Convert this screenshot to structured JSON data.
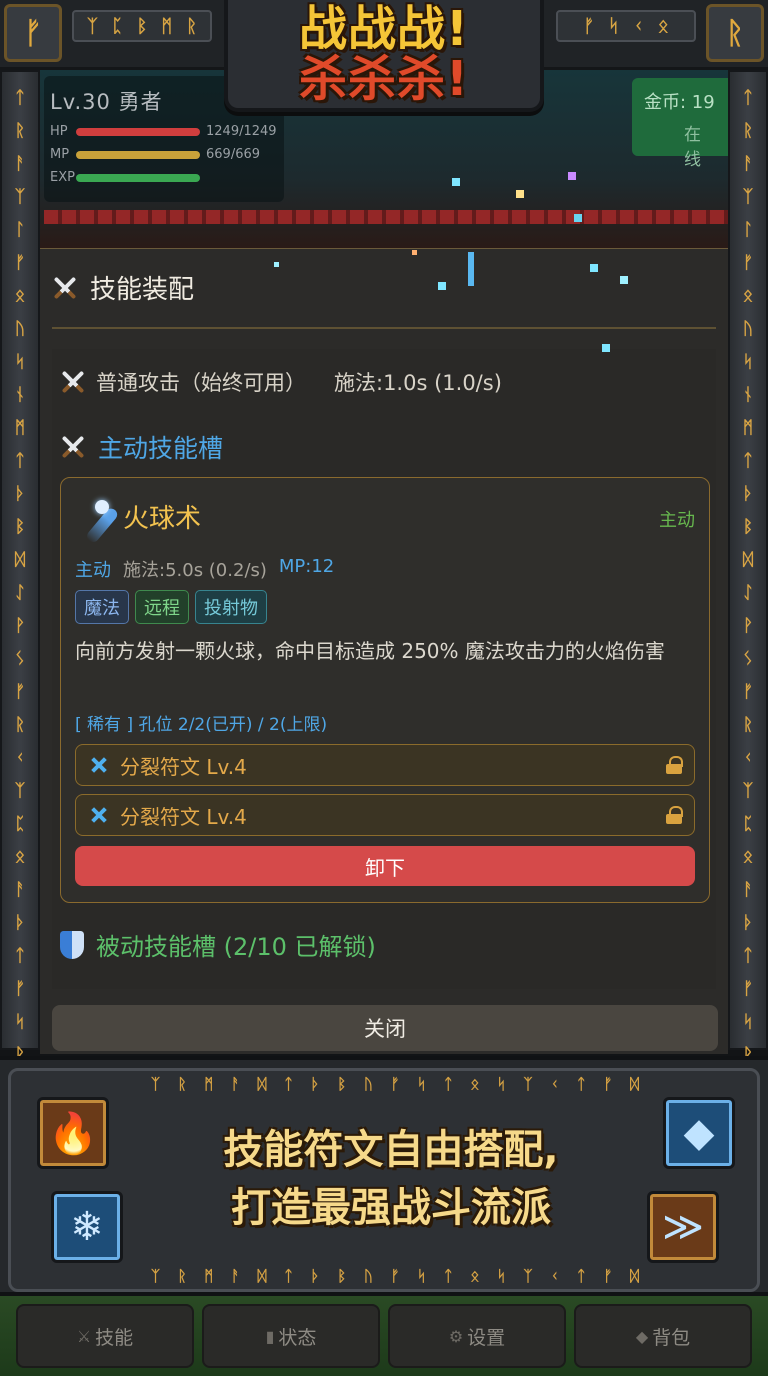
{
  "frame": {
    "top_runes_left": [
      "ᛉ",
      "ᛈ",
      "ᛒ",
      "ᛗ",
      "ᚱ"
    ],
    "top_runes_right": [
      "ᚠ",
      "ᛋ",
      "ᚲ",
      "ᛟ"
    ],
    "corner_left": "ᚠ",
    "corner_right": "ᚱ",
    "side_runes": [
      "ᛏ",
      "ᚱ",
      "ᚨ",
      "ᛉ",
      "ᛚ",
      "ᚠ",
      "ᛟ",
      "ᚢ",
      "ᛋ",
      "ᚾ",
      "ᛗ",
      "ᛏ",
      "ᚦ",
      "ᛒ",
      "ᛞ",
      "ᛇ",
      "ᚹ",
      "ᛊ",
      "ᚠ",
      "ᚱ",
      "ᚲ",
      "ᛉ",
      "ᛈ",
      "ᛟ",
      "ᚨ",
      "ᚦ",
      "ᛏ",
      "ᚠ",
      "ᛋ",
      "ᚱ",
      "ᛗ",
      "ᚠ",
      "ᛋ",
      "ᚱ",
      "ᚦ"
    ]
  },
  "logo": {
    "line1": "战战战!",
    "line2": "杀杀杀!"
  },
  "hud": {
    "title": "Lv.30 勇者",
    "hp_label": "HP",
    "hp_value": "1249/1249",
    "mp_label": "MP",
    "mp_value": "669/669",
    "xp_label": "EXP",
    "gold_label": "金币: 19",
    "gold_sub": "在线"
  },
  "panel": {
    "title": "技能装配",
    "basic_attack": "普通攻击（始终可用）",
    "basic_cast": "施法:1.0s (1.0/s)",
    "active_slot_title": "主动技能槽",
    "skill": {
      "name": "火球术",
      "kind": "主动",
      "type": "主动",
      "cast": "施法:5.0s (0.2/s)",
      "mp": "MP:12",
      "tags": [
        "魔法",
        "远程",
        "投射物"
      ],
      "description": "向前方发射一颗火球，命中目标造成 250% 魔法攻击力的火焰伤害",
      "slots": "[ 稀有 ] 孔位 2/2(已开) / 2(上限)",
      "runes": [
        "分裂符文 Lv.4",
        "分裂符文 Lv.4"
      ],
      "unequip_label": "卸下"
    },
    "passive_slot_title": "被动技能槽 (2/10 已解锁)",
    "close_label": "关闭"
  },
  "banner": {
    "line1": "技能符文自由搭配,",
    "line2": "打造最强战斗流派",
    "runes_top": [
      "ᛉ",
      "ᚱ",
      "ᛗ",
      "ᚨ",
      "ᛞ",
      "ᛏ",
      "ᚦ",
      "ᛒ",
      "ᚢ",
      "ᚠ",
      "ᛋ",
      "ᛏ",
      "ᛟ",
      "ᛋ",
      "ᛉ",
      "ᚲ",
      "ᛏ",
      "ᚠ",
      "ᛞ"
    ],
    "runes_bottom": [
      "ᛉ",
      "ᚱ",
      "ᛗ",
      "ᚨ",
      "ᛞ",
      "ᛏ",
      "ᚦ",
      "ᛒ",
      "ᚢ",
      "ᚠ",
      "ᛋ",
      "ᛏ",
      "ᛟ",
      "ᛋ",
      "ᛉ",
      "ᚲ",
      "ᛏ",
      "ᚠ",
      "ᛞ"
    ]
  },
  "nav": [
    {
      "label": "技能",
      "icon": "⚔"
    },
    {
      "label": "状态",
      "icon": "▮"
    },
    {
      "label": "设置",
      "icon": "⚙"
    },
    {
      "label": "背包",
      "icon": "◆"
    }
  ],
  "colors": {
    "accent_blue": "#4fa7e6",
    "skill_gold": "#f2c24f",
    "active_green": "#67b84e",
    "danger_red": "#d54a4a",
    "rune_gold": "#d8a444"
  }
}
